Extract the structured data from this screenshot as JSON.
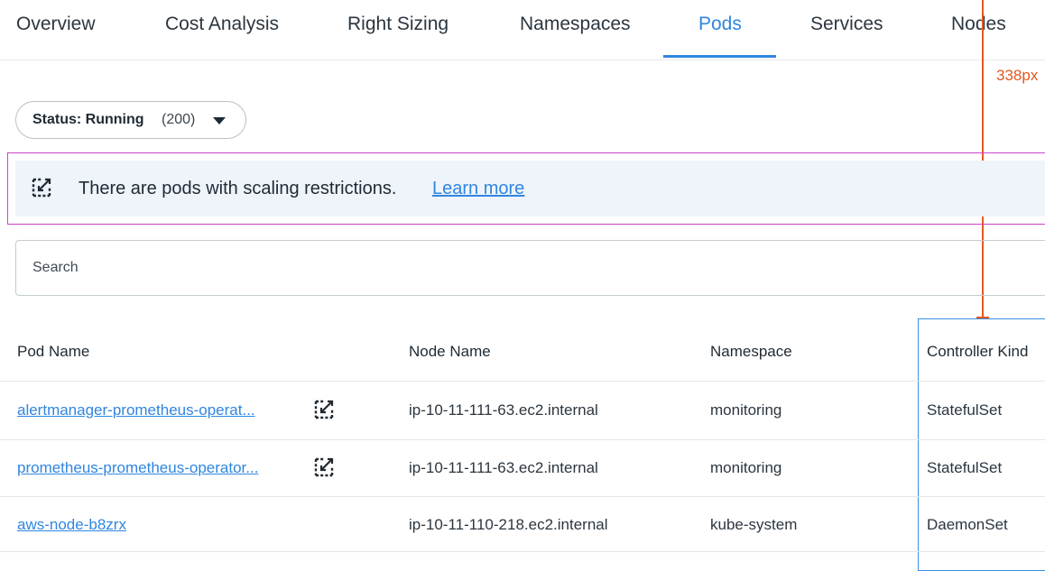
{
  "tabs": [
    {
      "label": "Overview",
      "active": false
    },
    {
      "label": "Cost Analysis",
      "active": false
    },
    {
      "label": "Right Sizing",
      "active": false
    },
    {
      "label": "Namespaces",
      "active": false
    },
    {
      "label": "Pods",
      "active": true
    },
    {
      "label": "Services",
      "active": false
    },
    {
      "label": "Nodes",
      "active": false
    }
  ],
  "annotation": {
    "measure_label": "338px"
  },
  "status_filter": {
    "label": "Status: Running",
    "count": "(200)"
  },
  "banner": {
    "message": "There are pods with scaling restrictions.",
    "link": "Learn more",
    "icon": "scaling-restriction-icon"
  },
  "search": {
    "placeholder": "Search",
    "value": ""
  },
  "table": {
    "columns": [
      "Pod Name",
      "Node Name",
      "Namespace",
      "Controller Kind"
    ],
    "rows": [
      {
        "pod": "alertmanager-prometheus-operat...",
        "restricted": true,
        "node": "ip-10-11-111-63.ec2.internal",
        "namespace": "monitoring",
        "kind": "StatefulSet"
      },
      {
        "pod": "prometheus-prometheus-operator...",
        "restricted": true,
        "node": "ip-10-11-111-63.ec2.internal",
        "namespace": "monitoring",
        "kind": "StatefulSet"
      },
      {
        "pod": "aws-node-b8zrx",
        "restricted": false,
        "node": "ip-10-11-110-218.ec2.internal",
        "namespace": "kube-system",
        "kind": "DaemonSet"
      }
    ]
  },
  "colors": {
    "accent": "#2f86e0",
    "annotation_orange": "#e2591f",
    "banner_bg": "#eff4fb",
    "banner_outline": "#cc44cc"
  }
}
